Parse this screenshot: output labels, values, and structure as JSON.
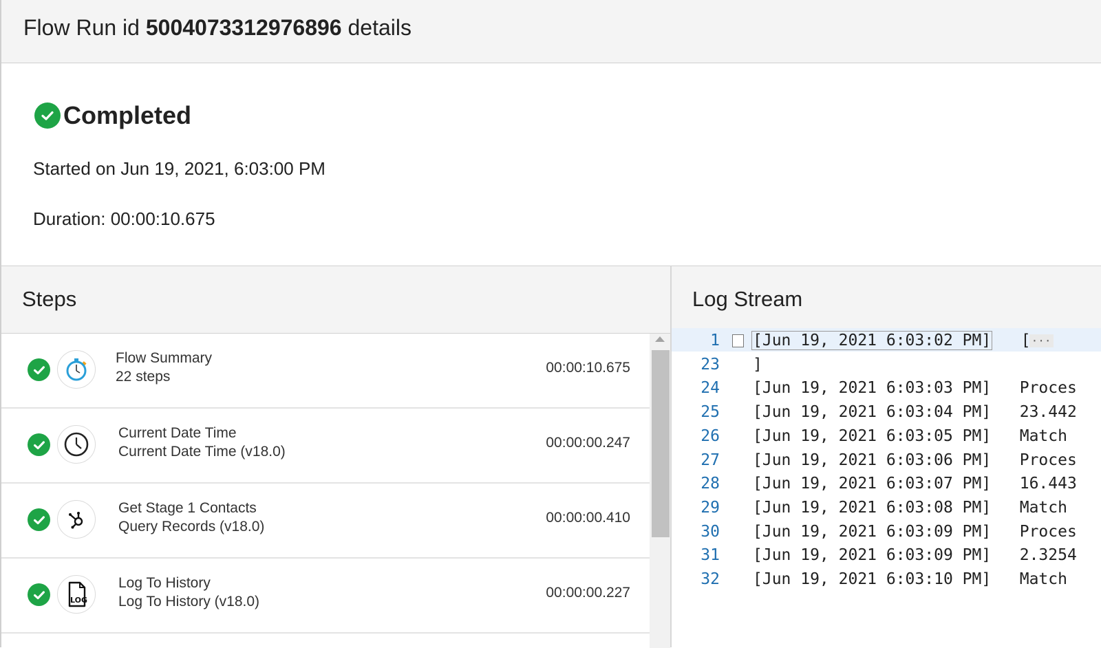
{
  "header": {
    "title_prefix": "Flow Run id",
    "run_id": "5004073312976896",
    "title_suffix": "details"
  },
  "status": {
    "label": "Completed",
    "started": "Started on Jun 19, 2021, 6:03:00 PM",
    "duration": "Duration: 00:00:10.675",
    "color": "#1ea446"
  },
  "steps": {
    "title": "Steps",
    "items": [
      {
        "title": "Flow Summary",
        "subtitle": "22 steps",
        "time": "00:00:10.675",
        "icon": "stopwatch-icon"
      },
      {
        "title": "Current Date Time",
        "subtitle": "Current Date Time (v18.0)",
        "time": "00:00:00.247",
        "icon": "clock-icon"
      },
      {
        "title": "Get Stage 1 Contacts",
        "subtitle": "Query Records (v18.0)",
        "time": "00:00:00.410",
        "icon": "hubspot-icon"
      },
      {
        "title": "Log To History",
        "subtitle": "Log To History (v18.0)",
        "time": "00:00:00.227",
        "icon": "log-file-icon"
      }
    ]
  },
  "log": {
    "title": "Log Stream",
    "lines": [
      {
        "num": "1",
        "ts": "[Jun 19, 2021 6:03:02 PM]",
        "msg": "[",
        "folded": true
      },
      {
        "num": "23",
        "ts": "]",
        "msg": ""
      },
      {
        "num": "24",
        "ts": "[Jun 19, 2021 6:03:03 PM]",
        "msg": "Proces"
      },
      {
        "num": "25",
        "ts": "[Jun 19, 2021 6:03:04 PM]",
        "msg": "23.442"
      },
      {
        "num": "26",
        "ts": "[Jun 19, 2021 6:03:05 PM]",
        "msg": "Match"
      },
      {
        "num": "27",
        "ts": "[Jun 19, 2021 6:03:06 PM]",
        "msg": "Proces"
      },
      {
        "num": "28",
        "ts": "[Jun 19, 2021 6:03:07 PM]",
        "msg": "16.443"
      },
      {
        "num": "29",
        "ts": "[Jun 19, 2021 6:03:08 PM]",
        "msg": "Match"
      },
      {
        "num": "30",
        "ts": "[Jun 19, 2021 6:03:09 PM]",
        "msg": "Proces"
      },
      {
        "num": "31",
        "ts": "[Jun 19, 2021 6:03:09 PM]",
        "msg": "2.3254"
      },
      {
        "num": "32",
        "ts": "[Jun 19, 2021 6:03:10 PM]",
        "msg": "Match"
      }
    ]
  }
}
